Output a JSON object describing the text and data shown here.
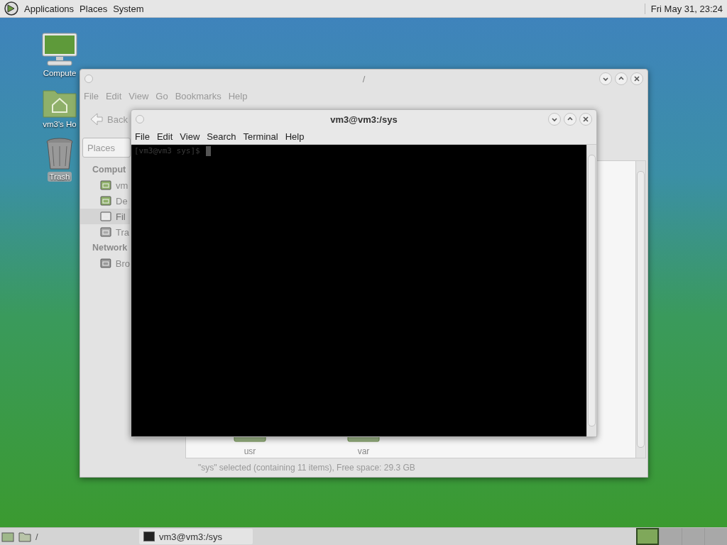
{
  "top_panel": {
    "menus": [
      "Applications",
      "Places",
      "System"
    ],
    "clock": "Fri May 31, 23:24"
  },
  "desktop_icons": [
    {
      "kind": "computer",
      "label": "Compute",
      "selected": false
    },
    {
      "kind": "home",
      "label": "vm3's Ho",
      "selected": false
    },
    {
      "kind": "trash",
      "label": "Trash",
      "selected": true
    }
  ],
  "file_manager": {
    "title": "/",
    "menus": [
      "File",
      "Edit",
      "View",
      "Go",
      "Bookmarks",
      "Help"
    ],
    "back_button": "Back",
    "places_dropdown": "Places",
    "sidebar": [
      {
        "heading": "Comput",
        "items": [
          {
            "kind": "home",
            "label": "vm",
            "selected": false
          },
          {
            "kind": "desktop",
            "label": "De",
            "selected": false
          },
          {
            "kind": "drive",
            "label": "Fil",
            "selected": true
          },
          {
            "kind": "trash",
            "label": "Tra",
            "selected": false
          }
        ]
      },
      {
        "heading": "Network",
        "items": [
          {
            "kind": "network",
            "label": "Bro",
            "selected": false
          }
        ]
      }
    ],
    "files": [
      {
        "name": "usr"
      },
      {
        "name": "var"
      }
    ],
    "status": "\"sys\" selected (containing 11 items), Free space: 29.3 GB"
  },
  "terminal": {
    "title": "vm3@vm3:/sys",
    "menus": [
      "File",
      "Edit",
      "View",
      "Search",
      "Terminal",
      "Help"
    ],
    "prompt": "[vm3@vm3 sys]$"
  },
  "bottom_panel": {
    "location": "/",
    "tasks": [
      {
        "label": "vm3@vm3:/sys",
        "selected": true
      }
    ],
    "workspaces": [
      {
        "selected": true
      },
      {
        "selected": false
      },
      {
        "selected": false
      },
      {
        "selected": false
      }
    ]
  }
}
